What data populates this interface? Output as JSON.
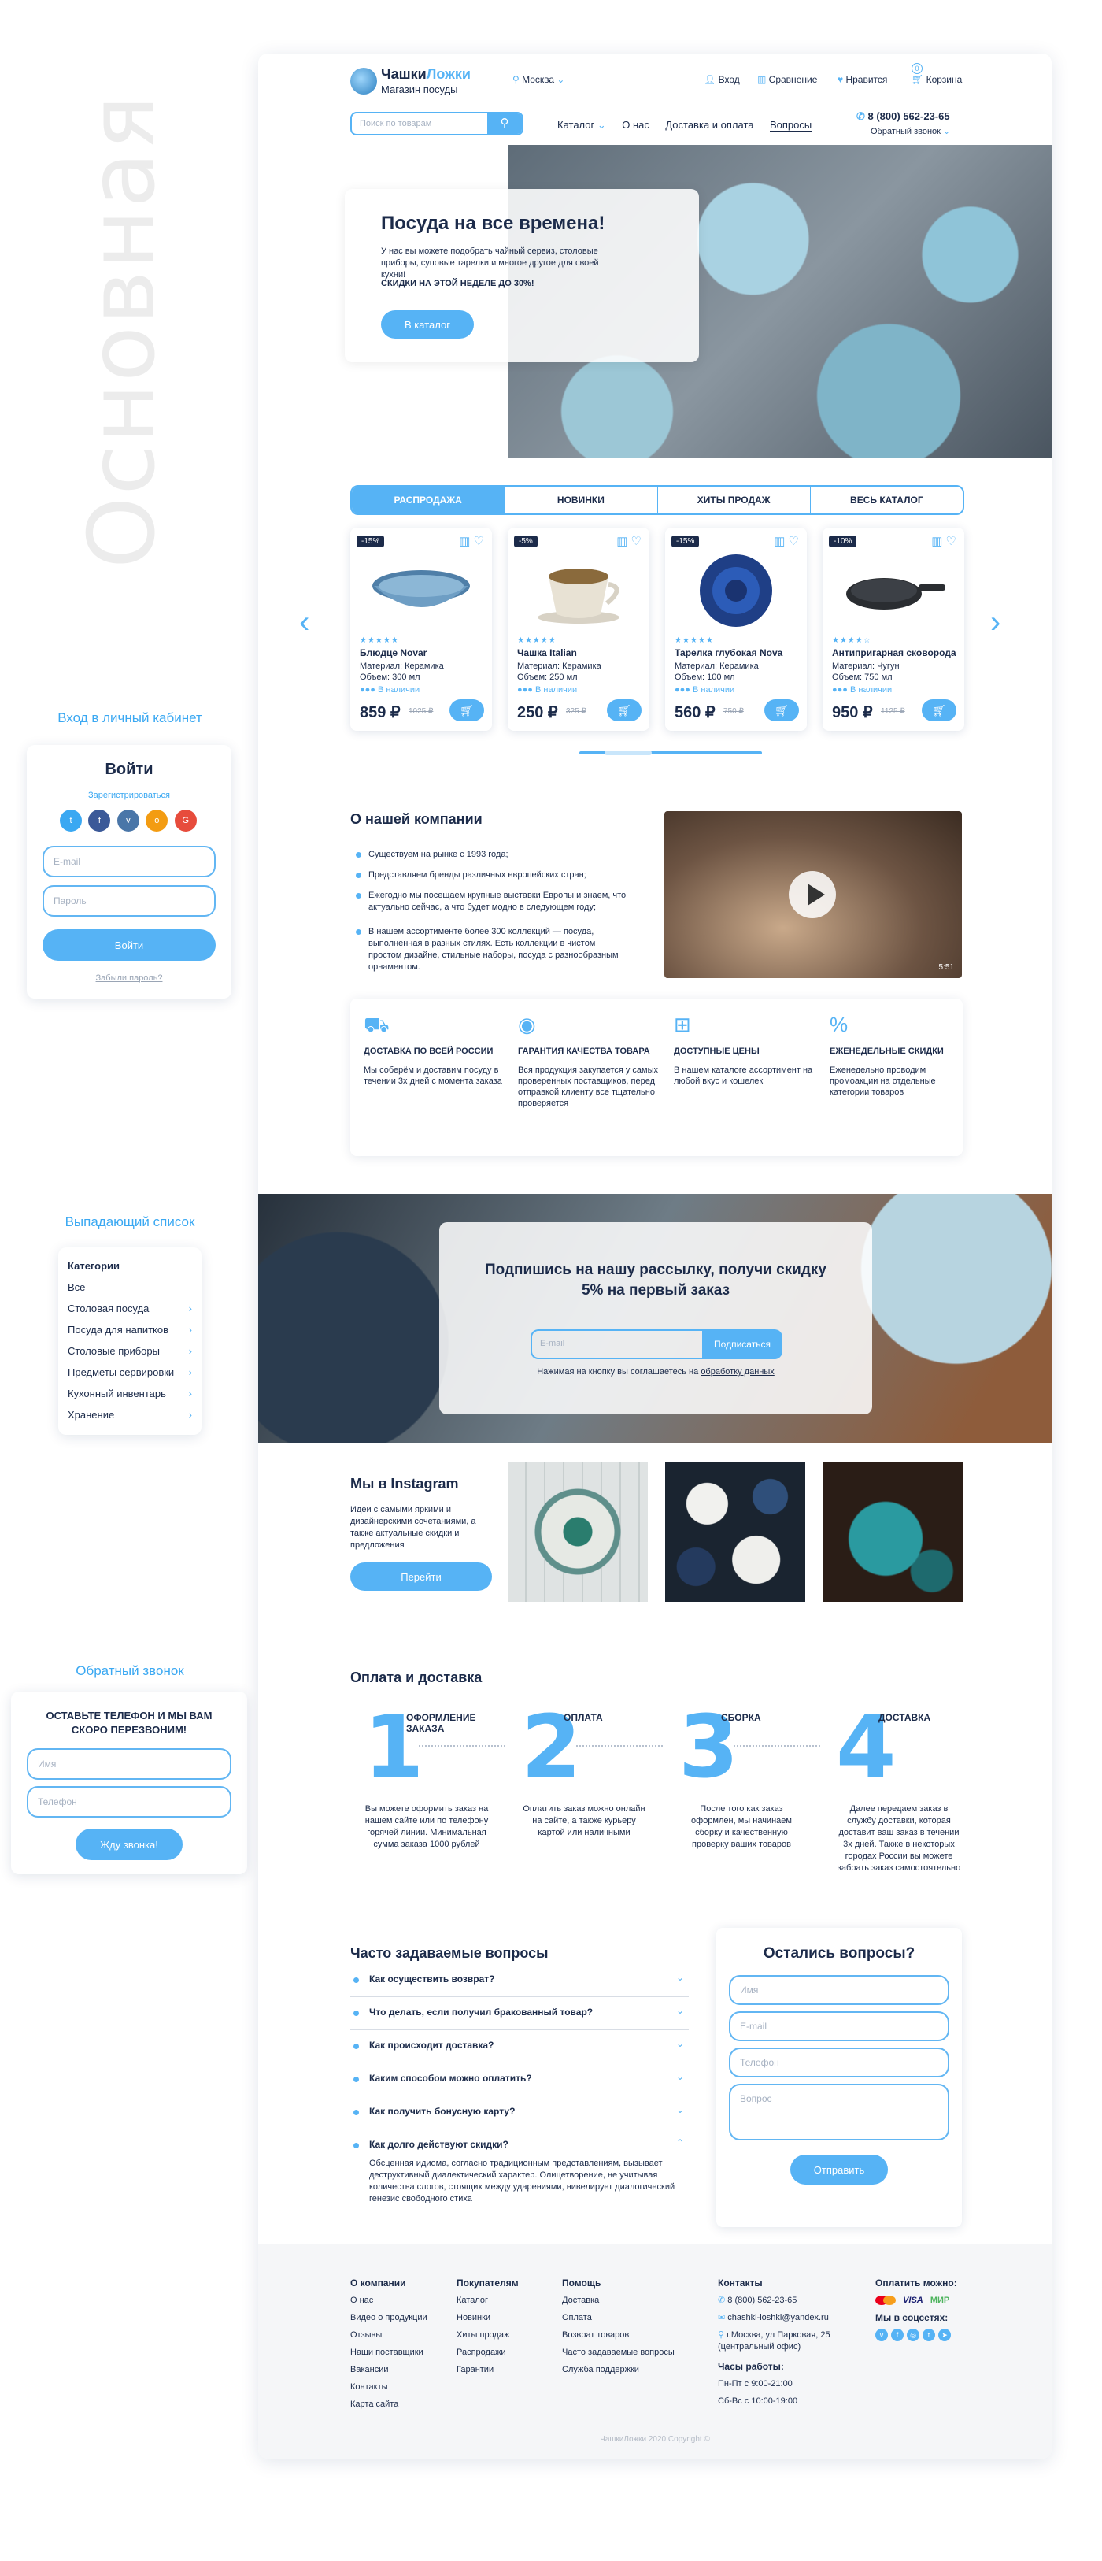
{
  "side": {
    "vertical_label": "Основная",
    "login": {
      "section_title": "Вход в личный кабинет",
      "title": "Войти",
      "register": "Зарегистрироваться",
      "email_ph": "E-mail",
      "password_ph": "Пароль",
      "submit": "Войти",
      "forgot": "Забыли пароль?"
    },
    "dropdown": {
      "section_title": "Выпадающий список",
      "header": "Категории",
      "items": [
        "Все",
        "Столовая посуда",
        "Посуда для напитков",
        "Столовые приборы",
        "Предметы сервировки",
        "Кухонный инвентарь",
        "Хранение"
      ]
    },
    "callback": {
      "section_title": "Обратный звонок",
      "text": "ОСТАВЬТЕ ТЕЛЕФОН И МЫ ВАМ СКОРО ПЕРЕЗВОНИМ!",
      "name_ph": "Имя",
      "phone_ph": "Телефон",
      "submit": "Жду звонка!"
    }
  },
  "header": {
    "logo_a": "Чашки",
    "logo_b": "Ложки",
    "logo_sub": "Магазин посуды",
    "city": "Москва",
    "login": "Вход",
    "compare": "Сравнение",
    "favorites": "Нравится",
    "cart": "Корзина",
    "cart_count": "0",
    "search_ph": "Поиск по товарам",
    "nav": [
      "Каталог",
      "О нас",
      "Доставка и оплата",
      "Вопросы"
    ],
    "phone": "8 (800) 562-23-65",
    "callback": "Обратный звонок"
  },
  "hero": {
    "title": "Посуда на все времена!",
    "text": "У нас вы можете подобрать чайный сервиз, столовые приборы, суповые тарелки и многое другое для своей кухни!",
    "promo": "СКИДКИ НА ЭТОЙ НЕДЕЛЕ ДО 30%!",
    "button": "В каталог"
  },
  "tabs": [
    "РАСПРОДАЖА",
    "НОВИНКИ",
    "ХИТЫ ПРОДАЖ",
    "ВЕСЬ КАТАЛОГ"
  ],
  "products": [
    {
      "discount": "-15%",
      "name": "Блюдце Novar",
      "material": "Материал: Керамика",
      "volume": "Объем: 300 мл",
      "stock": "В наличии",
      "price": "859 ₽",
      "old": "1025 ₽",
      "rating": 5
    },
    {
      "discount": "-5%",
      "name": "Чашка Italian",
      "material": "Материал: Керамика",
      "volume": "Объем: 250 мл",
      "stock": "В наличии",
      "price": "250 ₽",
      "old": "325 ₽",
      "rating": 5
    },
    {
      "discount": "-15%",
      "name": "Тарелка глубокая Nova",
      "material": "Материал: Керамика",
      "volume": "Объем: 100 мл",
      "stock": "В наличии",
      "price": "560 ₽",
      "old": "750 ₽",
      "rating": 5
    },
    {
      "discount": "-10%",
      "name": "Антипригарная сковорода",
      "material": "Материал: Чугун",
      "volume": "Объем: 750 мл",
      "stock": "В наличии",
      "price": "950 ₽",
      "old": "1125 ₽",
      "rating": 4
    }
  ],
  "about": {
    "title": "О нашей компании",
    "items": [
      "Существуем на рынке с 1993 года;",
      "Представляем бренды различных европейских стран;",
      "Ежегодно мы посещаем крупные выставки Европы и знаем, что актуально сейчас, а что будет модно в следующем году;",
      "В нашем ассортименте более 300 коллекций — посуда, выполненная в разных стилях. Есть коллекции в чистом простом дизайне, стильные наборы, посуда с разнообразным орнаментом."
    ],
    "video_time": "5:51"
  },
  "features": [
    {
      "icon": "truck-icon",
      "title": "ДОСТАВКА ПО ВСЕЙ РОССИИ",
      "text": "Мы соберём и доставим посуду в течении 3х дней с момента заказа"
    },
    {
      "icon": "thumb-icon",
      "title": "ГАРАНТИЯ КАЧЕСТВА ТОВАРА",
      "text": "Вся продукция закупается у самых проверенных поставщиков, перед отправкой клиенту все тщательно проверяется"
    },
    {
      "icon": "tag-icon",
      "title": "ДОСТУПНЫЕ ЦЕНЫ",
      "text": "В нашем каталоге ассортимент на любой вкус и кошелек"
    },
    {
      "icon": "percent-icon",
      "title": "ЕЖЕНЕДЕЛЬНЫЕ СКИДКИ",
      "text": "Еженедельно проводим промоакции на отдельные категории товаров"
    }
  ],
  "subscribe": {
    "title": "Подпишись на нашу рассылку, получи скидку 5% на первый заказ",
    "email_ph": "E-mail",
    "button": "Подписаться",
    "note": "Нажимая на кнопку вы соглашаетесь на",
    "link": "обработку данных"
  },
  "instagram": {
    "title": "Мы в Instagram",
    "text": "Идеи с самыми яркими и дизайнерскими сочетаниями, а также актуальные скидки и предложения",
    "button": "Перейти"
  },
  "payment": {
    "title": "Оплата и доставка",
    "steps": [
      {
        "n": "1",
        "title": "ОФОРМЛЕНИЕ ЗАКАЗА",
        "text": "Вы можете оформить заказ на нашем сайте или по телефону горячей линии. Минимальная сумма заказа 1000 рублей"
      },
      {
        "n": "2",
        "title": "ОПЛАТА",
        "text": "Оплатить заказ можно онлайн на сайте, а также курьеру картой или наличными"
      },
      {
        "n": "3",
        "title": "СБОРКА",
        "text": "После того как заказ оформлен, мы начинаем сборку и качественную проверку ваших товаров"
      },
      {
        "n": "4",
        "title": "ДОСТАВКА",
        "text": "Далее передаем заказ в службу доставки, которая доставит ваш заказ в течении 3х дней. Также в некоторых городах России вы можете забрать заказ самостоятельно"
      }
    ]
  },
  "faq": {
    "title": "Часто задаваемые вопросы",
    "items": [
      "Как осуществить возврат?",
      "Что делать, если получил бракованный товар?",
      "Как происходит доставка?",
      "Каким способом можно оплатить?",
      "Как получить бонусную карту?",
      "Как долго действуют скидки?"
    ],
    "answer": "Обсценная идиома, согласно традиционным представлениям, вызывает деструктивный диалектический характер. Олицетворение, не учитывая количества слогов, стоящих между ударениями, нивелирует диалогический генезис свободного стиха"
  },
  "questions": {
    "title": "Остались вопросы?",
    "name_ph": "Имя",
    "email_ph": "E-mail",
    "phone_ph": "Телефон",
    "question_ph": "Вопрос",
    "button": "Отправить"
  },
  "footer": {
    "col1": {
      "h": "О компании",
      "items": [
        "О нас",
        "Видео о продукции",
        "Отзывы",
        "Наши поставщики",
        "Вакансии",
        "Контакты",
        "Карта сайта"
      ]
    },
    "col2": {
      "h": "Покупателям",
      "items": [
        "Каталог",
        "Новинки",
        "Хиты продаж",
        "Распродажи",
        "Гарантии"
      ]
    },
    "col3": {
      "h": "Помощь",
      "items": [
        "Доставка",
        "Оплата",
        "Возврат товаров",
        "Часто задаваемые вопросы",
        "Служба поддержки"
      ]
    },
    "contacts": {
      "h": "Контакты",
      "phone": "8 (800) 562-23-65",
      "email": "chashki-loshki@yandex.ru",
      "address": "г.Москва, ул Парковая, 25 (центральный офис)",
      "hours_h": "Часы работы:",
      "hours1": "Пн-Пт с 9:00-21:00",
      "hours2": "Сб-Вс с 10:00-19:00"
    },
    "pay_h": "Оплатить можно:",
    "pay": [
      "VISA",
      "МИР"
    ],
    "social_h": "Мы в соцсетях:",
    "copyright": "ЧашкиЛожки 2020 Copyright ©"
  },
  "colors": {
    "accent": "#56b3f5",
    "dark": "#1c2b4a"
  }
}
